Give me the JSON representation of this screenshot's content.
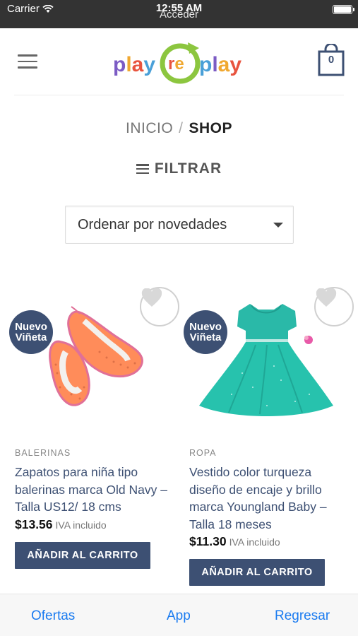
{
  "status_bar": {
    "carrier": "Carrier",
    "time": "12:55 AM",
    "page_label": "Acceder"
  },
  "header": {
    "logo_text": "playreplay",
    "cart_count": "0",
    "menu_icon": "hamburger-icon",
    "cart_icon": "shopping-bag-icon"
  },
  "breadcrumb": {
    "home": "INICIO",
    "separator": "/",
    "current": "SHOP"
  },
  "filter": {
    "label": "FILTRAR",
    "icon": "filter-lines-icon"
  },
  "sort": {
    "selected": "Ordenar por novedades"
  },
  "products": [
    {
      "badge_line1": "Nuevo",
      "badge_line2": "Viñeta",
      "category": "BALERINAS",
      "title": "Zapatos para niña tipo balerinas marca Old Navy – Talla US12/ 18 cms",
      "price": "$13.56",
      "tax_note": "IVA incluido",
      "button": "AÑADIR AL CARRITO",
      "image": "orange-ballet-flats"
    },
    {
      "badge_line1": "Nuevo",
      "badge_line2": "Viñeta",
      "category": "ROPA",
      "title": "Vestido color turqueza diseño de encaje y brillo marca Youngland Baby – Talla 18 meses",
      "price": "$11.30",
      "tax_note": "IVA incluido",
      "button": "AÑADIR AL CARRITO",
      "image": "turquoise-dress"
    }
  ],
  "tab_bar": {
    "left": "Ofertas",
    "center": "App",
    "right": "Regresar"
  },
  "colors": {
    "brand_navy": "#3d5073",
    "ios_blue": "#1a7bf0",
    "status_bar": "#333333"
  }
}
